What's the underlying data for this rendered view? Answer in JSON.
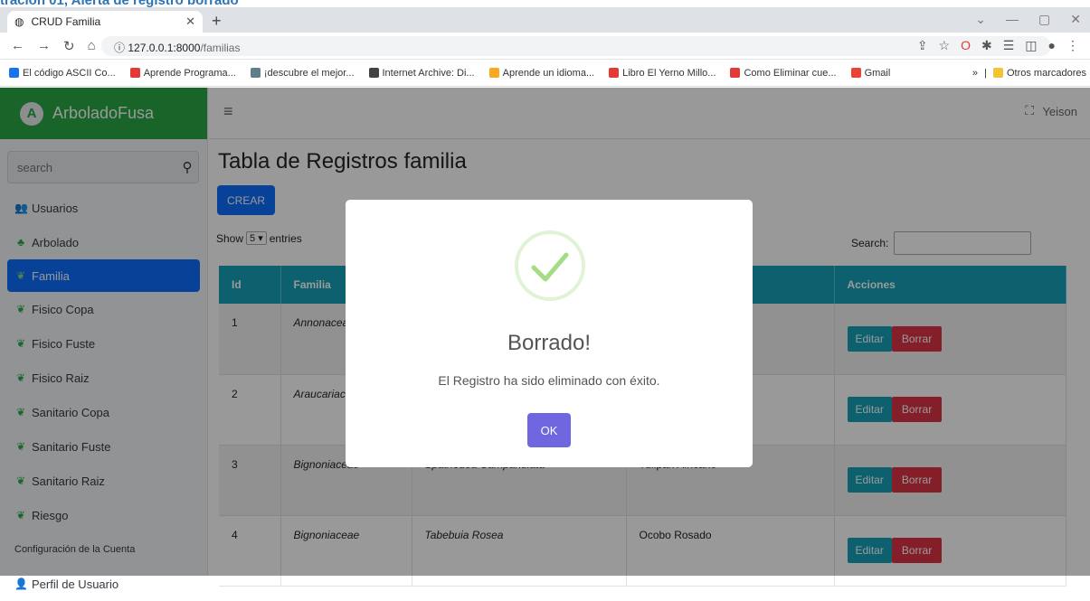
{
  "caption": "tración 01, Alerta de registro borrado",
  "browser": {
    "tab_title": "CRUD Familia",
    "url_host": "127.0.0.1:8000",
    "url_path": "/familias",
    "bookmarks": [
      {
        "label": "El código ASCII Co...",
        "color": "#1a73e8"
      },
      {
        "label": "Aprende Programa...",
        "color": "#e53935"
      },
      {
        "label": "¡descubre el mejor...",
        "color": "#607d8b"
      },
      {
        "label": "Internet Archive: Di...",
        "color": "#424242"
      },
      {
        "label": "Aprende un idioma...",
        "color": "#f9a825"
      },
      {
        "label": "Libro El Yerno Millo...",
        "color": "#e53935"
      },
      {
        "label": "Como Eliminar cue...",
        "color": "#e53935"
      },
      {
        "label": "Gmail",
        "color": "#ea4335"
      }
    ],
    "other_bookmarks": "Otros marcadores"
  },
  "app": {
    "brand": "ArboladoFusa",
    "brand_letter": "A",
    "user": "Yeison",
    "search_placeholder": "search",
    "nav": [
      {
        "label": "Usuarios",
        "icon": "users-icon"
      },
      {
        "label": "Arbolado",
        "icon": "tree-icon"
      },
      {
        "label": "Familia",
        "icon": "seedling-icon"
      },
      {
        "label": "Fisico Copa",
        "icon": "seedling-icon"
      },
      {
        "label": "Fisico Fuste",
        "icon": "seedling-icon"
      },
      {
        "label": "Fisico Raiz",
        "icon": "seedling-icon"
      },
      {
        "label": "Sanitario Copa",
        "icon": "seedling-icon"
      },
      {
        "label": "Sanitario Fuste",
        "icon": "seedling-icon"
      },
      {
        "label": "Sanitario Raiz",
        "icon": "seedling-icon"
      },
      {
        "label": "Riesgo",
        "icon": "seedling-icon"
      }
    ],
    "nav_header": "Configuración de la Cuenta",
    "profile_label": "Perfil de Usuario"
  },
  "page": {
    "title": "Tabla de Registros familia",
    "create_label": "CREAR",
    "show_label": "Show",
    "show_value": "5",
    "entries_label": "entries",
    "search_label": "Search:",
    "columns": [
      "Id",
      "Familia",
      "",
      "",
      "Acciones"
    ],
    "rows": [
      {
        "id": "1",
        "familia": "Annonaceae",
        "especie": "",
        "nombre": "",
        "edit": "Editar",
        "delete": "Borrar"
      },
      {
        "id": "2",
        "familia": "Araucariaceae",
        "especie": "",
        "nombre": "",
        "edit": "Editar",
        "delete": "Borrar"
      },
      {
        "id": "3",
        "familia": "Bignoniaceae",
        "especie": "Spathodea Campanulata",
        "nombre": "Tulipán Africano",
        "edit": "Editar",
        "delete": "Borrar"
      },
      {
        "id": "4",
        "familia": "Bignoniaceae",
        "especie": "Tabebuia Rosea",
        "nombre": "Ocobo Rosado",
        "edit": "Editar",
        "delete": "Borrar"
      }
    ]
  },
  "modal": {
    "title": "Borrado!",
    "text": "El Registro ha sido eliminado con éxito.",
    "ok_label": "OK",
    "accent": "#a5dc86"
  }
}
